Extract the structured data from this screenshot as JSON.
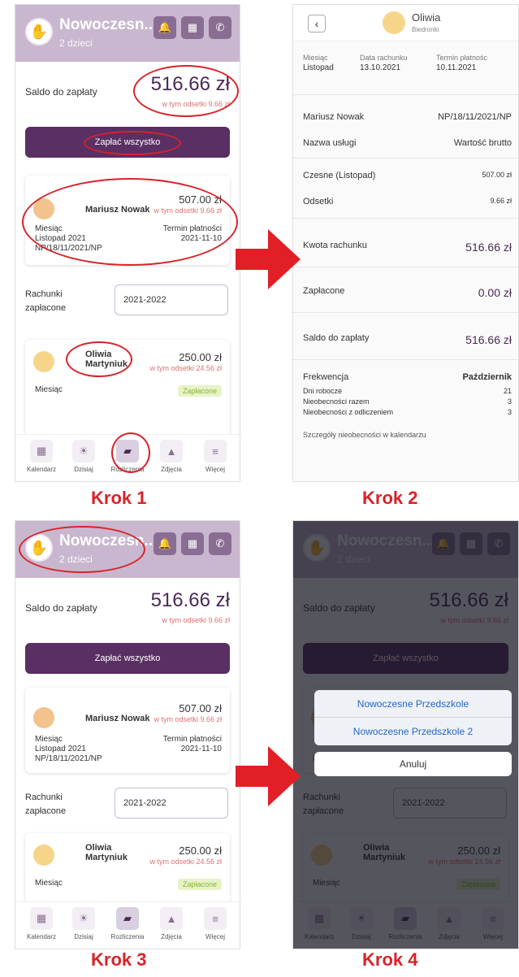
{
  "app": {
    "name": "Nowoczesn...",
    "children": "2 dzieci"
  },
  "saldo": {
    "label": "Saldo do zapłaty",
    "amount": "516.66 zł",
    "interest": "w tym odsetki 9.66 zł"
  },
  "pay_all": "Zapłać wszystko",
  "card1": {
    "name": "Mariusz Nowak",
    "amount": "507.00 zł",
    "interest": "w tym odsetki 9.66 zł",
    "month_label": "Miesiąc",
    "month": "Listopad 2021",
    "invoice": "NP/18/11/2021/NP",
    "due_label": "Termin płatności",
    "due": "2021-11-10"
  },
  "rachunki": {
    "label": "Rachunki zapłacone",
    "year": "2021-2022"
  },
  "card2": {
    "name": "Oliwia Martyniuk",
    "amount": "250.00 zł",
    "interest": "w tym odsetki 24.56 zł",
    "month_label": "Miesiąc",
    "status": "Zapłacone"
  },
  "nav": [
    {
      "label": "Kalendarz",
      "icon": "calendar-icon"
    },
    {
      "label": "Dzisiaj",
      "icon": "sun-icon"
    },
    {
      "label": "Rozliczenia",
      "icon": "wallet-icon"
    },
    {
      "label": "Zdjęcia",
      "icon": "image-icon"
    },
    {
      "label": "Więcej",
      "icon": "menu-icon"
    }
  ],
  "steps": [
    "Krok 1",
    "Krok 2",
    "Krok 3",
    "Krok 4"
  ],
  "detail": {
    "child": "Oliwia",
    "school": "Biedronki",
    "col1": "Miesiąc",
    "col1v": "Listopad",
    "col2": "Data rachunku",
    "col2v": "13.10.2021",
    "col3": "Termin płatnośc",
    "col3v": "10.11.2021",
    "payer": "Mariusz Nowak",
    "payer_inv": "NP/18/11/2021/NP",
    "service": "Nazwa usługi",
    "gross": "Wartość brutto",
    "fee": "Czesne (Listopad)",
    "fee_v": "507.00 zł",
    "interest": "Odsetki",
    "interest_v": "9.66 zł",
    "total": "Kwota rachunku",
    "total_v": "516.66 zł",
    "paid": "Zapłacone",
    "paid_v": "0.00 zł",
    "balance": "Saldo do zapłaty",
    "balance_v": "516.66 zł",
    "attendance": "Frekwencja",
    "att_month": "Październik",
    "workdays": "Dni robocze",
    "workdays_v": "21",
    "absences": "Nieobecności razem",
    "absences_v": "3",
    "absences_ded": "Nieobecności z odliczeniem",
    "absences_ded_v": "3",
    "details_link": "Szczegóły nieobecności w kalendarzu"
  },
  "sheet": {
    "opt1": "Nowoczesne Przedszkole",
    "opt2": "Nowoczesne Przedszkole 2",
    "cancel": "Anuluj"
  },
  "colors": {
    "accent": "#5a2f63",
    "header": "#c9b7cf",
    "annotation": "#d8232a"
  }
}
